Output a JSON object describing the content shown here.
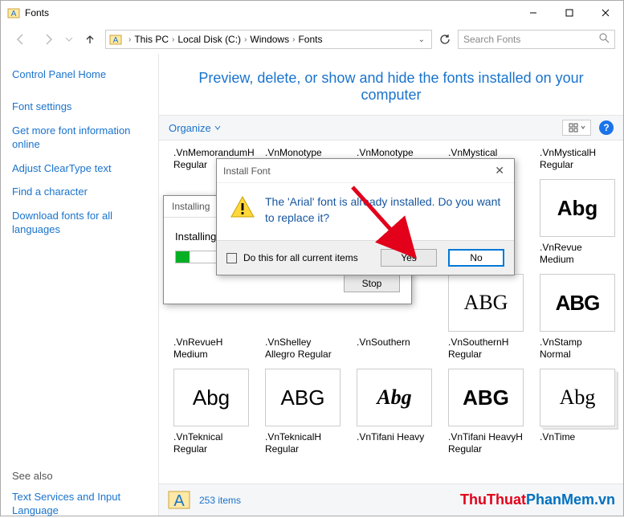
{
  "window": {
    "title": "Fonts"
  },
  "breadcrumb": {
    "root": "This PC",
    "drive": "Local Disk (C:)",
    "dir": "Windows",
    "leaf": "Fonts"
  },
  "search": {
    "placeholder": "Search Fonts"
  },
  "sidebar": {
    "home": "Control Panel Home",
    "links": [
      "Font settings",
      "Get more font information online",
      "Adjust ClearType text",
      "Find a character",
      "Download fonts for all languages"
    ],
    "seealso_h": "See also",
    "seealso": [
      "Text Services and Input Language"
    ]
  },
  "heading": "Preview, delete, or show and hide the fonts installed on your computer",
  "toolbar": {
    "organize": "Organize"
  },
  "row1_labels": [
    ".VnMemorandumH Regular",
    ".VnMonotype corsiva Italic",
    ".VnMonotype corsivaH Italic",
    ".VnMystical Regular",
    ".VnMysticalH Regular"
  ],
  "row2_labels": [
    "",
    "",
    "",
    "",
    ".VnRevue Medium"
  ],
  "row2_sample": "Abg",
  "row3_labels": [
    ".VnRevueH Medium",
    ".VnShelley Allegro Regular",
    ".VnSouthern",
    ".VnSouthernH Regular",
    ".VnStamp Normal"
  ],
  "row3_tiles": [
    "",
    "",
    "",
    "ABG",
    "ABG"
  ],
  "row4_labels": [
    ".VnTeknical Regular",
    ".VnTeknicalH Regular",
    ".VnTifani Heavy",
    ".VnTifani HeavyH Regular",
    ".VnTime"
  ],
  "row4_tiles": [
    "Abg",
    "ABG",
    "Abg",
    "ABG",
    "Abg"
  ],
  "status": {
    "count": "253 items"
  },
  "watermark": {
    "red": "ThuThuat",
    "blue": "PhanMem",
    "suffix": ".vn"
  },
  "dlg_install": {
    "title": "Installing",
    "progress_label": "Installing",
    "stop": "Stop"
  },
  "dlg_confirm": {
    "title": "Install Font",
    "message": "The 'Arial' font is already installed. Do you want to replace it?",
    "checkbox": "Do this for all current items",
    "yes": "Yes",
    "no": "No"
  }
}
